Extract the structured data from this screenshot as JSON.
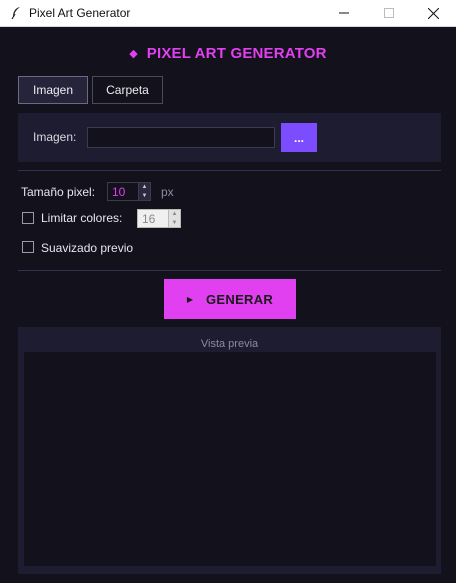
{
  "window": {
    "title": "Pixel Art Generator",
    "icon": "feather-icon"
  },
  "header": {
    "title": "PIXEL ART GENERATOR",
    "icon": "diamond-icon",
    "accent_color": "#e040f0"
  },
  "tabs": [
    {
      "label": "Imagen",
      "active": true
    },
    {
      "label": "Carpeta",
      "active": false
    }
  ],
  "file_picker": {
    "label": "Imagen:",
    "value": "",
    "browse_label": "...",
    "browse_color": "#7c4dff"
  },
  "options": {
    "pixel_size": {
      "label": "Tamaño pixel:",
      "value": "10",
      "unit": "px"
    },
    "limit_colors": {
      "label": "Limitar colores:",
      "checked": false,
      "value": "16"
    },
    "smoothing": {
      "label": "Suavizado previo",
      "checked": false
    }
  },
  "generate": {
    "label": "GENERAR",
    "icon": "play-icon"
  },
  "preview": {
    "title": "Vista previa"
  }
}
